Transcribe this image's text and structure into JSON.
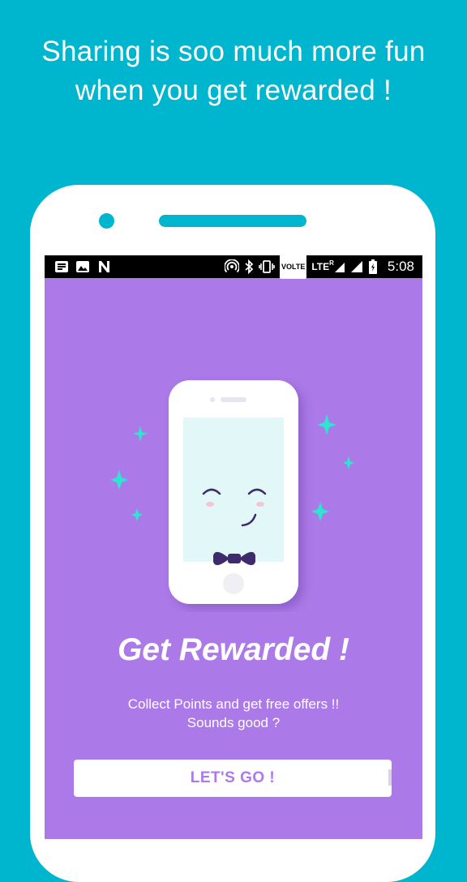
{
  "headline": {
    "line1": "Sharing is soo much more fun",
    "line2": "when you get rewarded !"
  },
  "status_bar": {
    "network": "LTE",
    "roaming": "R",
    "volte": "VOLTE",
    "time": "5:08",
    "icons_left": [
      "message-icon",
      "image-icon",
      "notification-n-icon"
    ],
    "icons_right": [
      "hotspot-icon",
      "bluetooth-icon",
      "vibrate-icon",
      "volte-badge",
      "lte-signal-icon",
      "signal-icon",
      "battery-icon"
    ]
  },
  "onboarding": {
    "title": "Get Rewarded !",
    "subtitle_line1": "Collect Points and get free offers !!",
    "subtitle_line2": "Sounds good ?",
    "cta_label": "LET'S GO !"
  },
  "colors": {
    "background": "#00B5CE",
    "screen": "#AB7AE8",
    "sparkle": "#2DE6D0",
    "bowtie": "#3D2B6B"
  }
}
